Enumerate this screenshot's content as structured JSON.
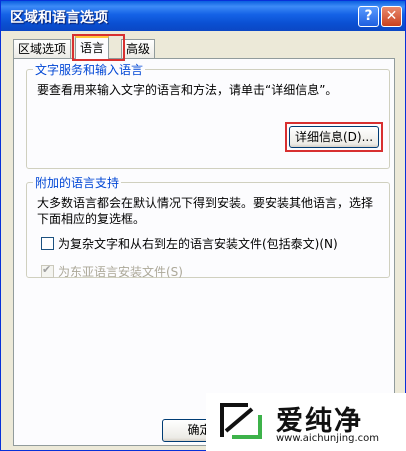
{
  "window": {
    "title": "区域和语言选项",
    "help_glyph": "?",
    "close_glyph": "✕"
  },
  "tabs": [
    {
      "label": "区域选项",
      "selected": false
    },
    {
      "label": "语言",
      "selected": true
    },
    {
      "label": "高级",
      "selected": false
    }
  ],
  "text_services": {
    "legend": "文字服务和输入语言",
    "description": "要查看用来输入文字的语言和方法，请单击“详细信息”。",
    "details_button": "详细信息(D)..."
  },
  "supplemental": {
    "legend": "附加的语言支持",
    "description_line1": "大多数语言都会在默认情况下得到安装。要安装其他语言，选择",
    "description_line2": "下面相应的复选框。",
    "complex_script": {
      "label": "为复杂文字和从右到左的语言安装文件(包括泰文)(N)",
      "checked": false
    },
    "east_asian": {
      "label": "为东亚语言安装文件(S)",
      "checked": true,
      "disabled": true
    }
  },
  "footer": {
    "ok_button": "确定"
  },
  "watermark": {
    "text": "爱纯净",
    "url": "www.aichunjing.com"
  },
  "colors": {
    "title_bar": "#0a4fd2",
    "legend_text": "#0046d5",
    "highlight_box": "#d83030",
    "dialog_bg": "#ece9d8"
  },
  "icons": {
    "help": "help-icon",
    "close": "close-icon",
    "watermark_logo": "aichunjing-logo"
  }
}
